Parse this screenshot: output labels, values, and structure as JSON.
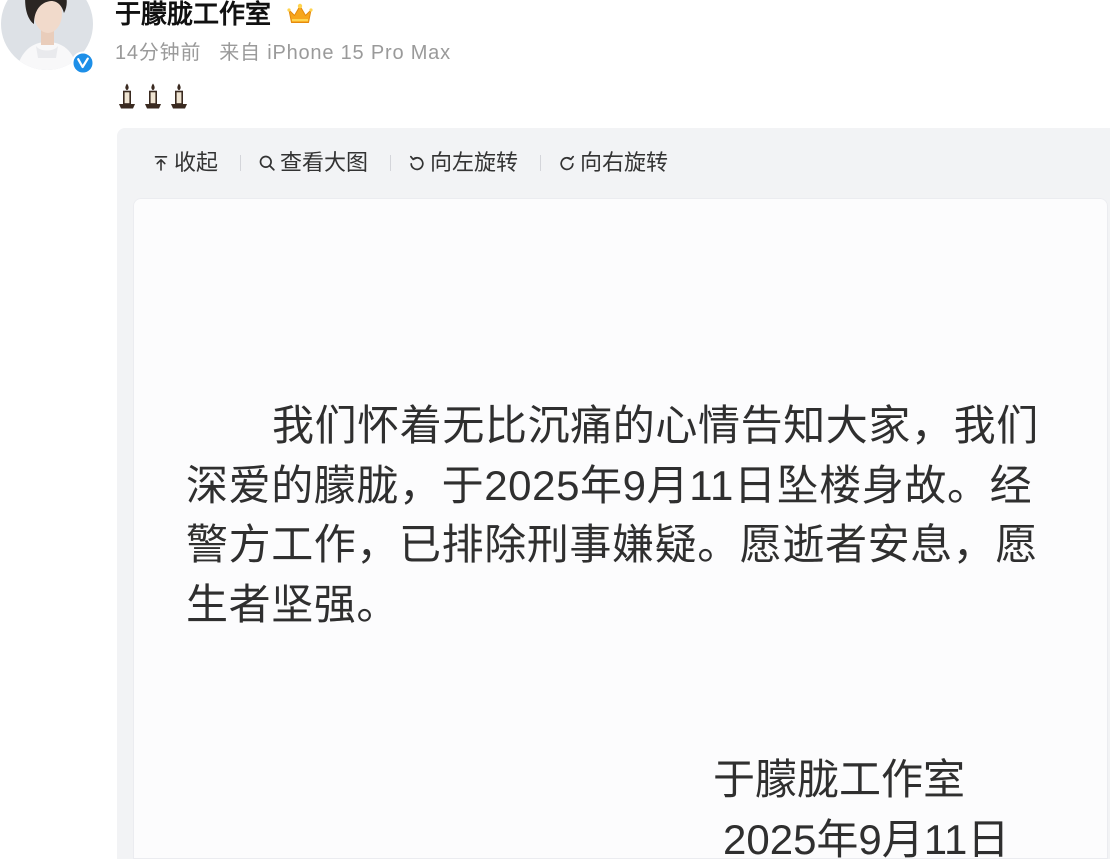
{
  "post": {
    "author": {
      "name": "于朦胧工作室",
      "avatar": "avatar-image",
      "verified_icon": "verified-badge-icon",
      "member_icon": "crown-icon"
    },
    "meta": {
      "time": "14分钟前",
      "source": "来自 iPhone 15 Pro Max"
    },
    "text_emoji": [
      "candle-icon",
      "candle-icon",
      "candle-icon"
    ]
  },
  "image_viewer": {
    "toolbar": [
      {
        "icon": "collapse-icon",
        "label": "收起"
      },
      {
        "icon": "search-icon",
        "label": "查看大图"
      },
      {
        "icon": "rotate-left-icon",
        "label": "向左旋转"
      },
      {
        "icon": "rotate-right-icon",
        "label": "向右旋转"
      }
    ]
  },
  "image": {
    "announcement_lines": [
      "我们怀着无比沉痛的心情告知大家，我们",
      "深爱的朦胧，于2025年9月11日坠楼身故。经",
      "警方工作，已排除刑事嫌疑。愿逝者安息，愿",
      "生者坚强。"
    ],
    "signature": {
      "name": "于朦胧工作室",
      "date": "2025年9月11日"
    }
  },
  "colors": {
    "verified_blue": "#1d8fe8",
    "crown_gold": "#f7a61c",
    "meta_text": "#9a9a9a",
    "panel_background": "#f2f3f5",
    "text_dark": "#333333"
  }
}
